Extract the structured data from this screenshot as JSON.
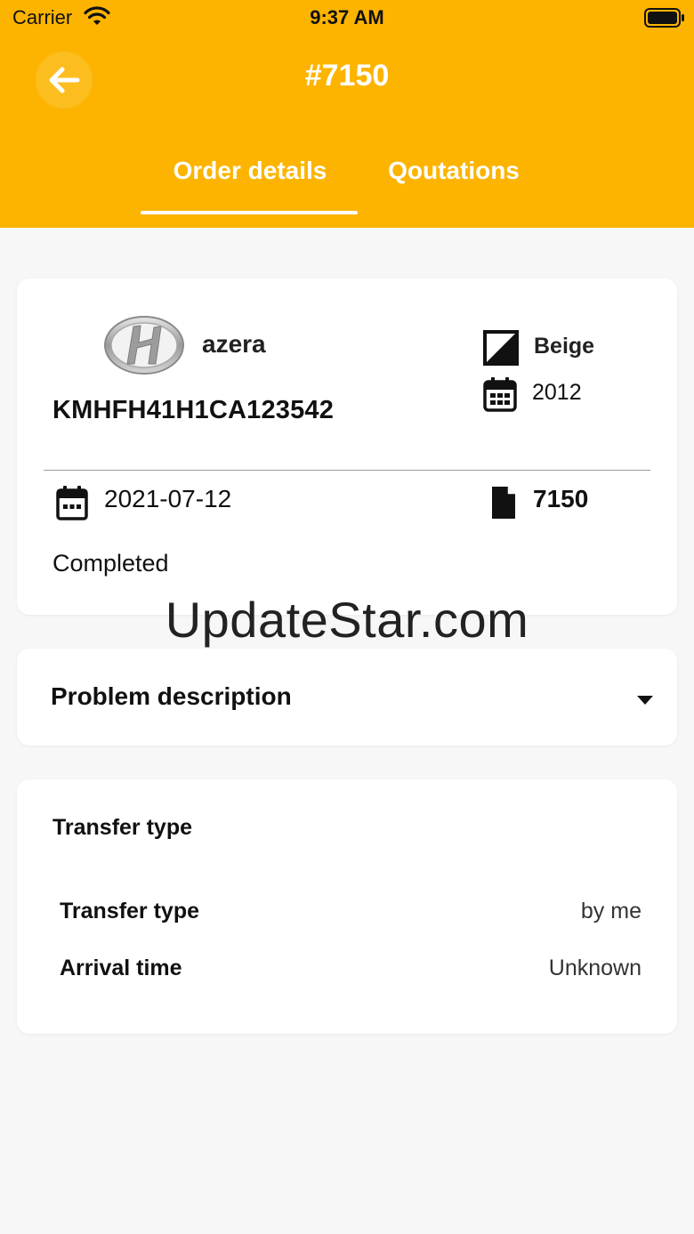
{
  "status_bar": {
    "carrier": "Carrier",
    "time": "9:37 AM"
  },
  "header": {
    "title": "#7150",
    "back_icon": "arrow-left-icon"
  },
  "tabs": [
    {
      "label": "Order details",
      "active": true
    },
    {
      "label": "Qoutations",
      "active": false
    }
  ],
  "vehicle": {
    "brand_logo": "hyundai-logo",
    "model": "azera",
    "vin": "KMHFH41H1CA123542",
    "color": "Beige",
    "year": "2012",
    "date": "2021-07-12",
    "order_number": "7150",
    "status": "Completed"
  },
  "problem": {
    "title": "Problem description"
  },
  "transfer": {
    "header": "Transfer type",
    "rows": [
      {
        "label": "Transfer type",
        "value": "by me"
      },
      {
        "label": "Arrival time",
        "value": "Unknown"
      }
    ]
  },
  "watermark": "UpdateStar.com",
  "colors": {
    "accent": "#fcb400",
    "background": "#f7f7f7",
    "card": "#ffffff"
  }
}
